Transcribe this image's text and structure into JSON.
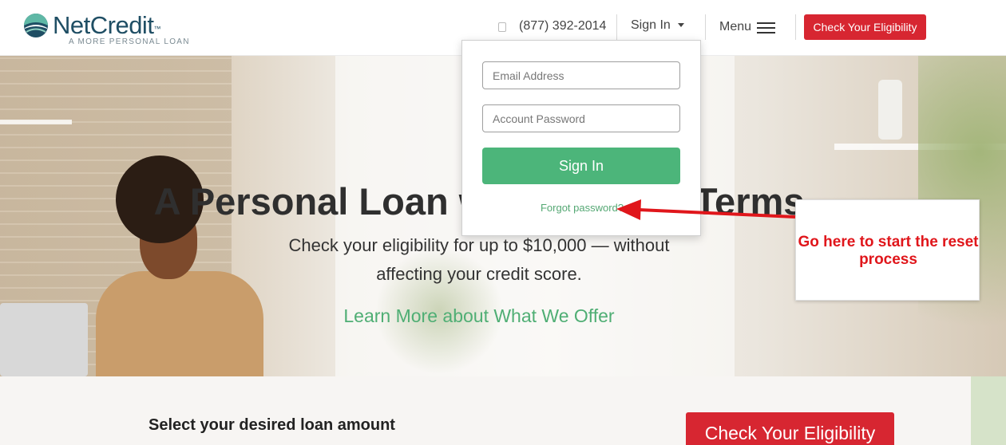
{
  "header": {
    "logo_name": "NetCredit",
    "logo_tm": "™",
    "logo_tagline": "A MORE PERSONAL LOAN",
    "phone": "(877) 392-2014",
    "signin_label": "Sign In",
    "menu_label": "Menu",
    "cta_label": "Check Your Eligibility"
  },
  "hero": {
    "title": "A Personal Loan with Flexible Terms",
    "subtitle": "Check your eligibility for up to $10,000 — without affecting your credit score.",
    "learn_more": "Learn More about What We Offer"
  },
  "signin_dropdown": {
    "email_placeholder": "Email Address",
    "password_placeholder": "Account Password",
    "button_label": "Sign In",
    "forgot_label": "Forgot password?"
  },
  "bottom": {
    "loan_label": "Select your desired loan amount",
    "cta_label": "Check Your Eligibility"
  },
  "annotation": {
    "text": "Go here to start the reset process",
    "color": "#e0161b"
  },
  "colors": {
    "brand_red": "#d72631",
    "brand_green": "#4cb57a",
    "logo_navy": "#1f4e64"
  }
}
